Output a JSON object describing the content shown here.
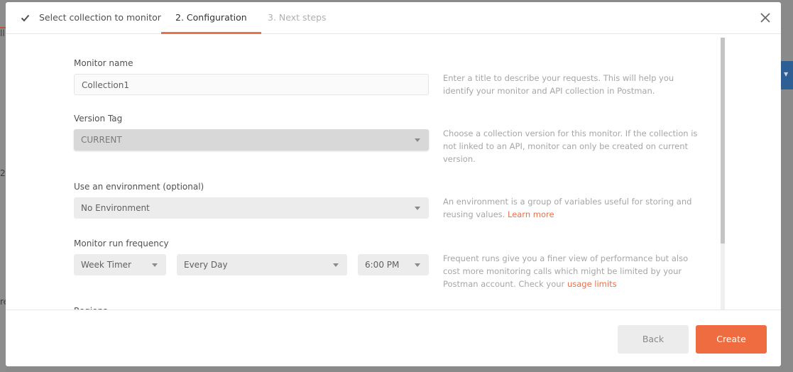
{
  "background": {
    "fragments": [
      "ll",
      "2",
      "re"
    ]
  },
  "tabs": [
    {
      "label": "Select collection to monitor",
      "state": "completed",
      "icon": "check-icon"
    },
    {
      "label": "2. Configuration",
      "state": "active"
    },
    {
      "label": "3. Next steps",
      "state": "disabled"
    }
  ],
  "close_icon": "close-icon",
  "form": {
    "monitor_name": {
      "label": "Monitor name",
      "value": "Collection1",
      "help": "Enter a title to describe your requests. This will help you identify your monitor and API collection in Postman."
    },
    "version_tag": {
      "label": "Version Tag",
      "value": "CURRENT",
      "disabled": true,
      "help": "Choose a collection version for this monitor. If the collection is not linked to an API, monitor can only be created on current version."
    },
    "environment": {
      "label": "Use an environment (optional)",
      "value": "No Environment",
      "help": "An environment is a group of variables useful for storing and reusing values.",
      "help_link": "Learn more"
    },
    "frequency": {
      "label": "Monitor run frequency",
      "timer_type": "Week Timer",
      "day": "Every Day",
      "time": "6:00 PM",
      "help": "Frequent runs give you a finer view of performance but also cost more monitoring calls which might be limited by your Postman account. Check your",
      "help_link": "usage limits"
    },
    "next_section_label": "Regions"
  },
  "footer": {
    "back_label": "Back",
    "create_label": "Create"
  },
  "colors": {
    "accent": "#ee6c3f",
    "link": "#e8704a"
  }
}
